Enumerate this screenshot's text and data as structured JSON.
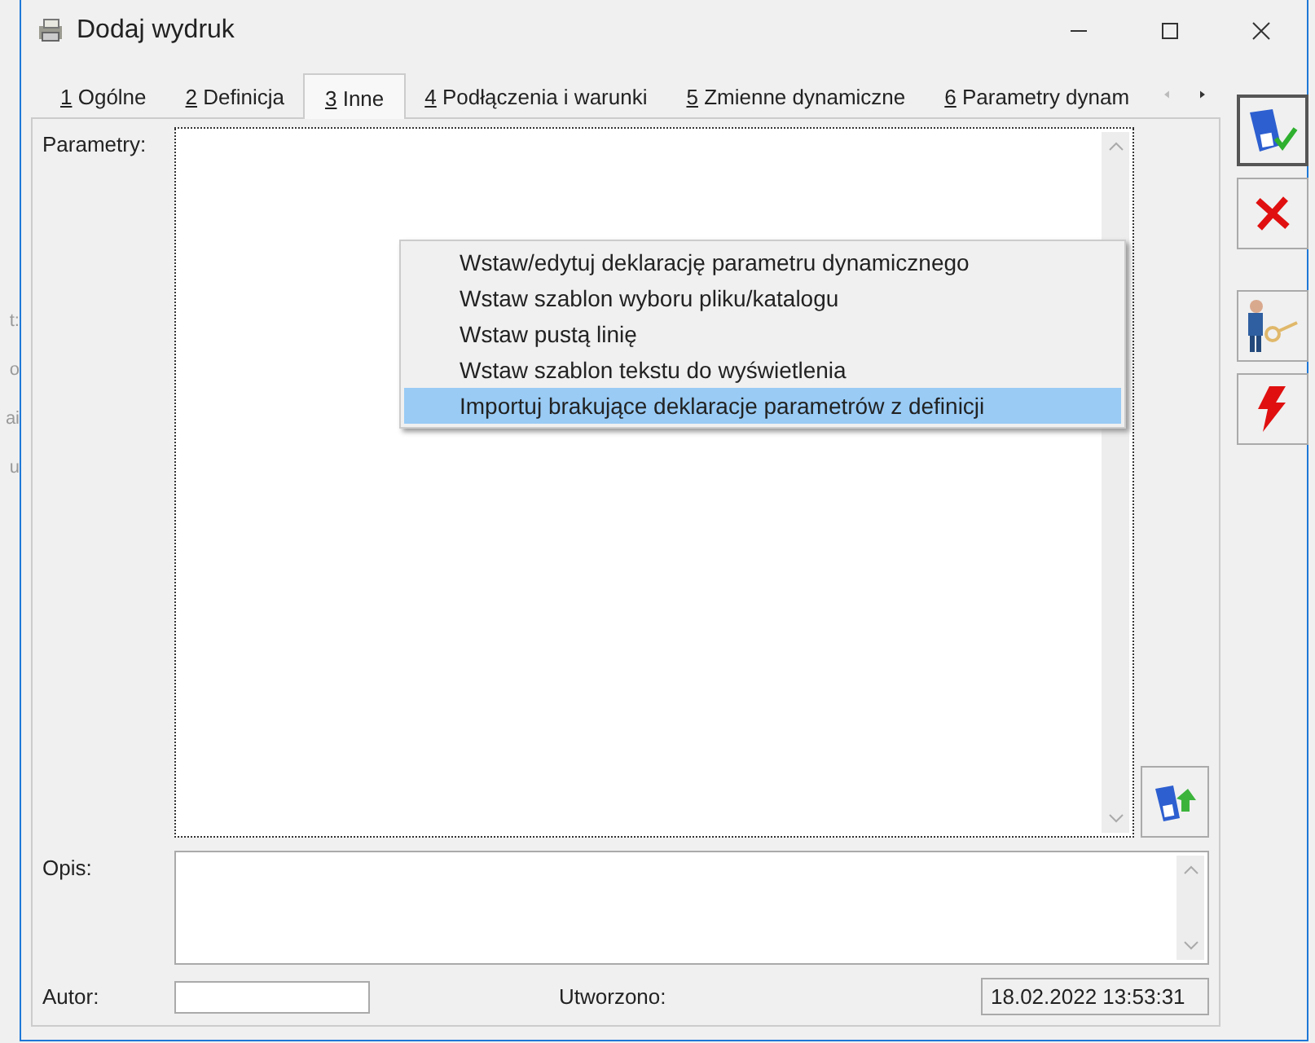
{
  "background_fragments": [
    "t:",
    "o",
    "ai",
    "u"
  ],
  "window": {
    "title": "Dodaj wydruk"
  },
  "tabs": [
    {
      "key": "1",
      "label": "Ogólne",
      "selected": false
    },
    {
      "key": "2",
      "label": "Definicja",
      "selected": false
    },
    {
      "key": "3",
      "label": "Inne",
      "selected": true
    },
    {
      "key": "4",
      "label": "Podłączenia i warunki",
      "selected": false
    },
    {
      "key": "5",
      "label": "Zmienne dynamiczne",
      "selected": false
    },
    {
      "key": "6",
      "label": "Parametry dynam",
      "selected": false
    }
  ],
  "form": {
    "parameters_label": "Parametry:",
    "description_label": "Opis:",
    "author_label": "Autor:",
    "created_label": "Utworzono:",
    "created_value": "18.02.2022 13:53:31"
  },
  "context_menu": [
    {
      "label": "Wstaw/edytuj deklarację parametru dynamicznego",
      "selected": false
    },
    {
      "label": "Wstaw szablon wyboru pliku/katalogu",
      "selected": false
    },
    {
      "label": "Wstaw pustą linię",
      "selected": false
    },
    {
      "label": "Wstaw szablon tekstu do wyświetlenia",
      "selected": false
    },
    {
      "label": "Importuj brakujące deklaracje parametrów z definicji",
      "selected": true
    }
  ]
}
